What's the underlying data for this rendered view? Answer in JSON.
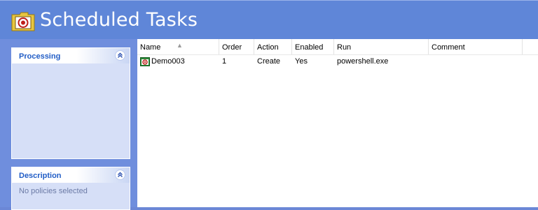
{
  "header": {
    "title": "Scheduled Tasks",
    "icon": "scheduled-tasks-folder-icon"
  },
  "panels": [
    {
      "title": "Processing",
      "body": ""
    },
    {
      "title": "Description",
      "body": "No policies selected"
    }
  ],
  "columns": [
    "Name",
    "Order",
    "Action",
    "Enabled",
    "Run",
    "Comment"
  ],
  "rows": [
    {
      "name": "Demo003",
      "order": "1",
      "action": "Create",
      "enabled": "Yes",
      "run": "powershell.exe",
      "comment": ""
    }
  ],
  "colors": {
    "header_bg": "#5f86d8",
    "panel_title": "#215dc6",
    "pane_bg": "#6f8edd"
  }
}
